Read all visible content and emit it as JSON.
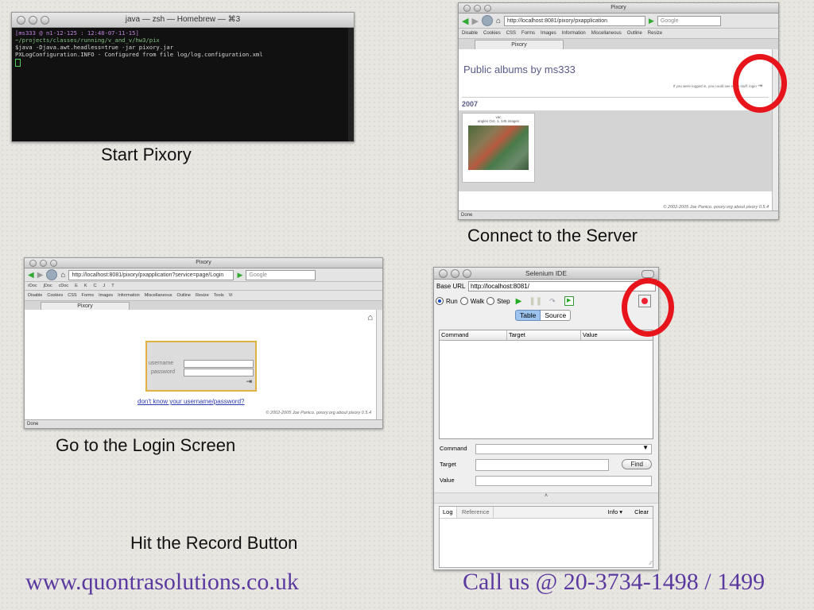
{
  "terminal": {
    "title": "java — zsh — Homebrew — ⌘3",
    "lines": [
      "[ms333 @ n1-12-125 : 12:48-07-11-15]",
      "~/projects/classes/running/v_and_v/hw3/pix",
      "$java -Djava.awt.headless=true -jar pixory.jar",
      "PXLogConfiguration.INFO - Configured from file log/log.configuration.xml"
    ],
    "caption": "Start Pixory"
  },
  "browser1": {
    "title": "Pixory",
    "url": "http://localhost:8081/pixory/pxapplication",
    "search_placeholder": "Google",
    "devbar": [
      "Disable",
      "Cookies",
      "CSS",
      "Forms",
      "Images",
      "Information",
      "Miscellaneous",
      "Outline",
      "Resize"
    ],
    "tab": "Pixory",
    "heading": "Public albums by ms333",
    "login_note": "If you were logged in, you could see more stuff.",
    "login_link": "login",
    "year": "2007",
    "album_title": "vac",
    "album_meta": "angles Oct. 1, 145 images",
    "footer": "© 2002-2005 Joe Panico. pixory.org about pixory 0.5.4",
    "status": "Done",
    "caption": "Connect to the Server"
  },
  "browser2": {
    "title": "Pixory",
    "url": "http://localhost:8081/pixory/pxapplication?service=page/Login",
    "search_placeholder": "Google",
    "bookmarks": [
      "rDoc",
      "jDoc",
      "cDoc",
      "E",
      "K",
      "C",
      "J",
      "T"
    ],
    "devbar": [
      "Disable",
      "Cookies",
      "CSS",
      "Forms",
      "Images",
      "Information",
      "Miscellaneous",
      "Outline",
      "Resize",
      "Tools",
      "Vi"
    ],
    "tab": "Pixory",
    "username_label": "username",
    "password_label": "password",
    "forgot_link": "don't know your username/password?",
    "footer": "© 2002-2005 Joe Panico. pixory.org about pixory 0.5.4",
    "status": "Done",
    "caption": "Go to the Login Screen"
  },
  "selenium": {
    "title": "Selenium IDE",
    "base_url_label": "Base URL",
    "base_url": "http://localhost:8081/",
    "modes": [
      "Run",
      "Walk",
      "Step"
    ],
    "tabs": [
      "Table",
      "Source"
    ],
    "columns": [
      "Command",
      "Target",
      "Value"
    ],
    "command_label": "Command",
    "target_label": "Target",
    "value_label": "Value",
    "find_button": "Find",
    "log_tabs": [
      "Log",
      "Reference"
    ],
    "info_menu": "Info ▾",
    "clear_button": "Clear",
    "caption": "Hit the Record Button"
  },
  "footer": {
    "website": "www.quontrasolutions.co.uk",
    "phone": "Call us @ 20-3734-1498 / 1499"
  },
  "colors": {
    "highlight": "#e8141c",
    "footer_text": "#5b3aa0"
  }
}
